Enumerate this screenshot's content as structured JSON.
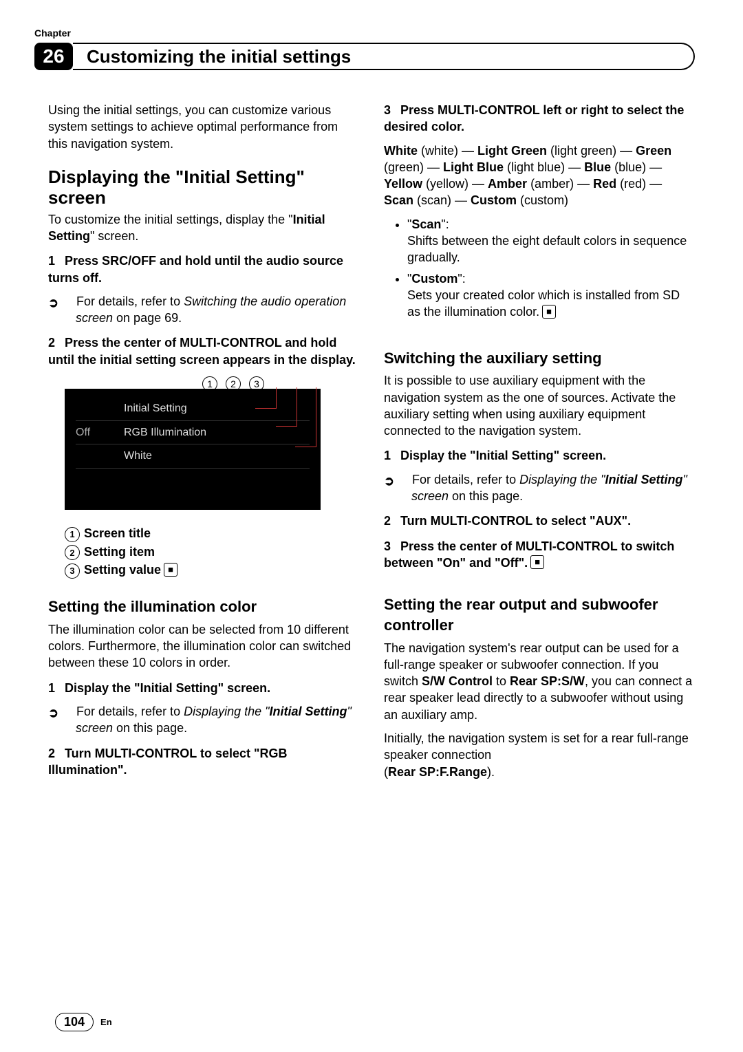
{
  "chapter": {
    "label": "Chapter",
    "number": "26",
    "title": "Customizing the initial settings"
  },
  "left": {
    "intro": "Using the initial settings, you can customize various system settings to achieve optimal performance from this navigation system.",
    "sec_display": {
      "title": "Displaying the \"Initial Setting\" screen",
      "lead": "To customize the initial settings, display the \"",
      "lead_bold": "Initial Setting",
      "lead_end": "\" screen.",
      "step1": "Press SRC/OFF and hold until the audio source turns off.",
      "ref1_pre": "For details, refer to ",
      "ref1_it": "Switching the audio operation screen",
      "ref1_post": " on page 69.",
      "step2": "Press the center of MULTI-CONTROL and hold until the initial setting screen appears in the display.",
      "screen": {
        "off": "Off",
        "line1": "Initial Setting",
        "line2": "RGB Illumination",
        "line3": "White"
      },
      "callouts": {
        "c1": "1",
        "c2": "2",
        "c3": "3"
      },
      "legend": {
        "l1": "Screen title",
        "l2": "Setting item",
        "l3": "Setting value"
      }
    },
    "sec_color": {
      "title": "Setting the illumination color",
      "lead": "The illumination color can be selected from 10 different colors. Furthermore, the illumination color can switched between these 10 colors in order.",
      "step1": "Display the \"Initial Setting\" screen.",
      "ref1_pre": "For details, refer to ",
      "ref1_it_a": "Displaying the \"",
      "ref1_bold": "Initial Setting",
      "ref1_it_b": "\" screen",
      "ref1_post": " on this page.",
      "step2": "Turn MULTI-CONTROL to select \"RGB Illumination\"."
    }
  },
  "right": {
    "step3_title": "Press MULTI-CONTROL left or right to select the desired color.",
    "colors_line": [
      {
        "b": "White",
        "n": " (white) — "
      },
      {
        "b": "Light Green",
        "n": " (light green) — "
      },
      {
        "b": "Green",
        "n": " (green) — "
      },
      {
        "b": "Light Blue",
        "n": " (light blue) — "
      },
      {
        "b": "Blue",
        "n": " (blue) — "
      },
      {
        "b": "Yellow",
        "n": " (yellow) — "
      },
      {
        "b": "Amber",
        "n": " (amber) — "
      },
      {
        "b": "Red",
        "n": " (red) — "
      },
      {
        "b": "Scan",
        "n": " (scan) — "
      },
      {
        "b": "Custom",
        "n": " (custom)"
      }
    ],
    "scan_label": "Scan",
    "scan_desc": "Shifts between the eight default colors in sequence gradually.",
    "custom_label": "Custom",
    "custom_desc": "Sets your created color which is installed from SD as the illumination color.",
    "sec_aux": {
      "title": "Switching the auxiliary setting",
      "lead": "It is possible to use auxiliary equipment with the navigation system as the one of sources. Activate the auxiliary setting when using auxiliary equipment connected to the navigation system.",
      "step1": "Display the \"Initial Setting\" screen.",
      "ref_pre": "For details, refer to ",
      "ref_it_a": "Displaying the \"",
      "ref_bold": "Initial Setting",
      "ref_it_b": "\" screen",
      "ref_post": " on this page.",
      "step2": "Turn MULTI-CONTROL to select \"AUX\".",
      "step3": "Press the center of MULTI-CONTROL to switch between \"On\" and \"Off\"."
    },
    "sec_rear": {
      "title": "Setting the rear output and subwoofer controller",
      "p1_a": "The navigation system's rear output can be used for a full-range speaker or subwoofer connection. If you switch ",
      "p1_b": "S/W Control",
      "p1_c": " to ",
      "p1_d": "Rear SP:S/W",
      "p1_e": ", you can connect a rear speaker lead directly to a subwoofer without using an auxiliary amp.",
      "p2_a": "Initially, the navigation system is set for a rear full-range speaker connection",
      "p2_b": "(",
      "p2_c": "Rear SP:F.Range",
      "p2_d": ")."
    }
  },
  "footer": {
    "page": "104",
    "lang": "En"
  }
}
